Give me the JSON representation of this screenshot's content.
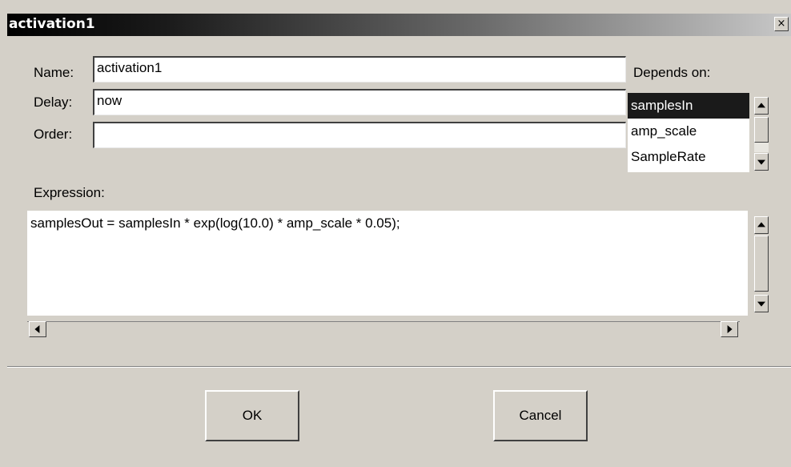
{
  "window": {
    "title": "activation1",
    "close_glyph": "×"
  },
  "form": {
    "name_label": "Name:",
    "name_value": "activation1",
    "delay_label": "Delay:",
    "delay_value": "now",
    "order_label": "Order:",
    "order_value": "",
    "depends_label": "Depends on:",
    "depends_items": [
      "samplesIn",
      "amp_scale",
      "SampleRate"
    ],
    "depends_selected": "samplesIn",
    "expression_label": "Expression:",
    "expression_value": "samplesOut = samplesIn * exp(log(10.0) * amp_scale * 0.05);"
  },
  "buttons": {
    "ok": "OK",
    "cancel": "Cancel"
  },
  "colors": {
    "selection": "#1a1a1a",
    "dialog_bg": "#d4d0c8"
  },
  "icons": {
    "close": "close-icon",
    "scroll_up": "arrow-up-icon",
    "scroll_down": "arrow-down-icon",
    "scroll_left": "arrow-left-icon",
    "scroll_right": "arrow-right-icon"
  }
}
